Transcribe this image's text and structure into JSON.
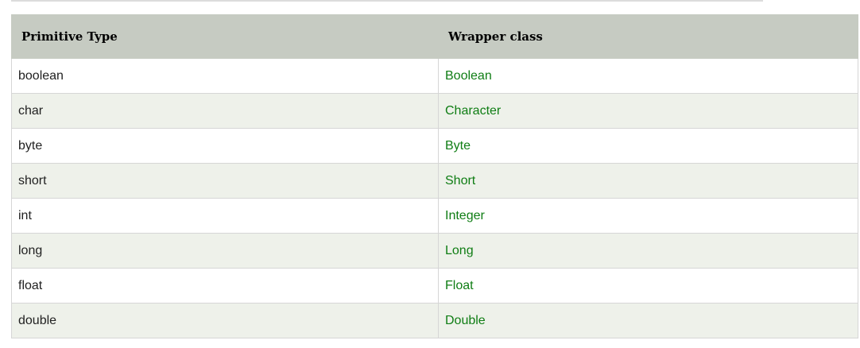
{
  "table": {
    "headers": [
      "Primitive Type",
      "Wrapper class"
    ],
    "rows": [
      {
        "primitive": "boolean",
        "wrapper": "Boolean"
      },
      {
        "primitive": "char",
        "wrapper": "Character"
      },
      {
        "primitive": "byte",
        "wrapper": "Byte"
      },
      {
        "primitive": "short",
        "wrapper": "Short"
      },
      {
        "primitive": "int",
        "wrapper": "Integer"
      },
      {
        "primitive": "long",
        "wrapper": "Long"
      },
      {
        "primitive": "float",
        "wrapper": "Float"
      },
      {
        "primitive": "double",
        "wrapper": "Double"
      }
    ]
  },
  "colors": {
    "header_bg": "#c6cbc2",
    "stripe_bg": "#eef1ea",
    "wrapper_text": "#0f7d14",
    "border": "#d6d6d6"
  }
}
